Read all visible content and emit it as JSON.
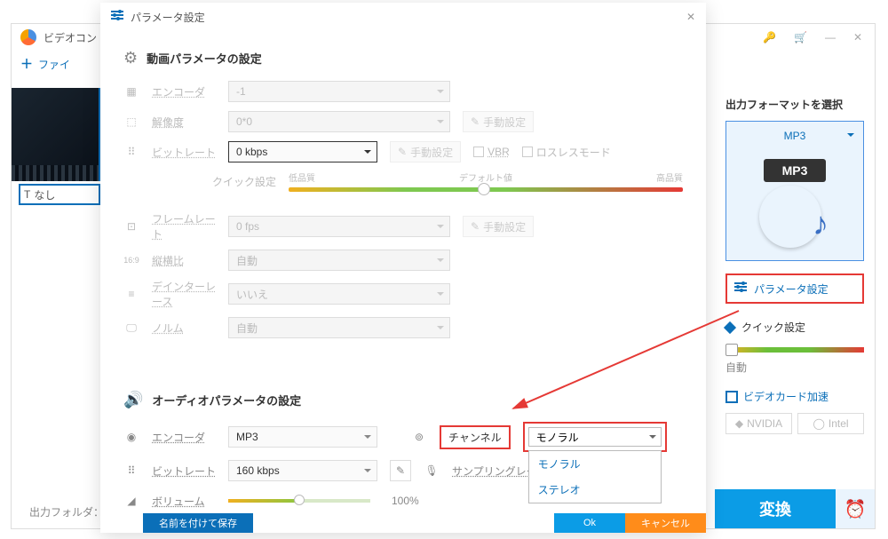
{
  "main": {
    "title": "ビデオコン",
    "add_file": "ファイ",
    "subtitle": "なし",
    "output_folder_label": "出力フォルダ："
  },
  "right": {
    "format_title": "出力フォーマットを選択",
    "format_selected": "MP3",
    "mp3_tag": "MP3",
    "param_button": "パラメータ設定",
    "quick_label": "クイック設定",
    "auto": "自動",
    "gpu_label": "ビデオカード加速",
    "nvidia": "NVIDIA",
    "intel": "Intel",
    "convert": "変換"
  },
  "dialog": {
    "title": "パラメータ設定",
    "video_section": "動画パラメータの設定",
    "audio_section": "オーディオパラメータの設定",
    "labels": {
      "encoder": "エンコーダ",
      "resolution": "解像度",
      "bitrate": "ビットレート",
      "quick": "クイック設定",
      "framerate": "フレームレート",
      "aspect": "縦横比",
      "deinterlace": "デインターレース",
      "norm": "ノルム",
      "channel": "チャンネル",
      "samplerate": "サンプリングレート",
      "volume": "ボリューム"
    },
    "values": {
      "v_encoder": "-1",
      "v_resolution": "0*0",
      "v_bitrate": "0 kbps",
      "v_framerate": "0 fps",
      "v_aspect": "自動",
      "v_deinterlace": "いいえ",
      "v_norm": "自動",
      "a_encoder": "MP3",
      "a_bitrate": "160 kbps",
      "a_channel": "モノラル",
      "volume_pct": "100%"
    },
    "quality": {
      "low": "低品質",
      "default": "デフォルト値",
      "high": "高品質"
    },
    "manual": "手動設定",
    "vbr": "VBR",
    "lossless": "ロスレスモード",
    "channel_options": [
      "モノラル",
      "ステレオ"
    ],
    "buttons": {
      "save_as": "名前を付けて保存",
      "ok": "Ok",
      "cancel": "キャンセル"
    }
  }
}
